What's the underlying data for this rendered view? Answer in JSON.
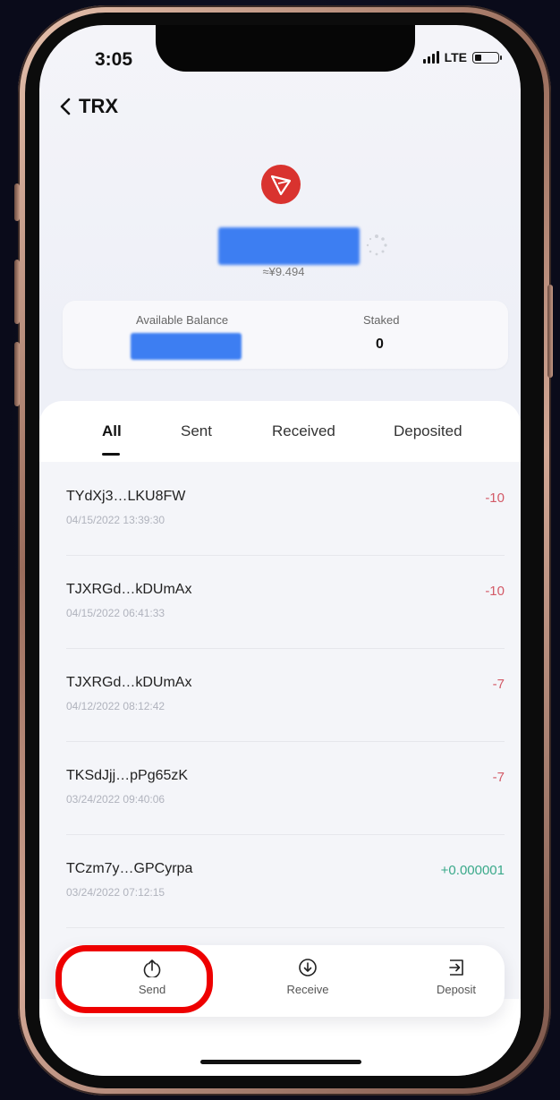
{
  "status_bar": {
    "time": "3:05",
    "network": "LTE"
  },
  "header": {
    "back_label": "TRX"
  },
  "asset": {
    "logo": "tron-logo-icon",
    "fiat_value": "≈¥9.494",
    "brand_color": "#d9332f"
  },
  "balance_card": {
    "available_label": "Available Balance",
    "staked_label": "Staked",
    "staked_value": "0"
  },
  "tabs": [
    {
      "label": "All"
    },
    {
      "label": "Sent"
    },
    {
      "label": "Received"
    },
    {
      "label": "Deposited"
    }
  ],
  "transactions": [
    {
      "address": "TYdXj3…LKU8FW",
      "date": "04/15/2022 13:39:30",
      "amount": "-10"
    },
    {
      "address": "TJXRGd…kDUmAx",
      "date": "04/15/2022 06:41:33",
      "amount": "-10"
    },
    {
      "address": "TJXRGd…kDUmAx",
      "date": "04/12/2022 08:12:42",
      "amount": "-7"
    },
    {
      "address": "TKSdJjj…pPg65zK",
      "date": "03/24/2022 09:40:06",
      "amount": "-7"
    },
    {
      "address": "TCzm7y…GPCyrpa",
      "date": "03/24/2022 07:12:15",
      "amount": "+0.000001"
    }
  ],
  "actions": {
    "send": "Send",
    "receive": "Receive",
    "deposit": "Deposit"
  },
  "colors": {
    "negative": "#d35a67",
    "positive": "#3aa98a",
    "highlight": "#ee0000"
  }
}
